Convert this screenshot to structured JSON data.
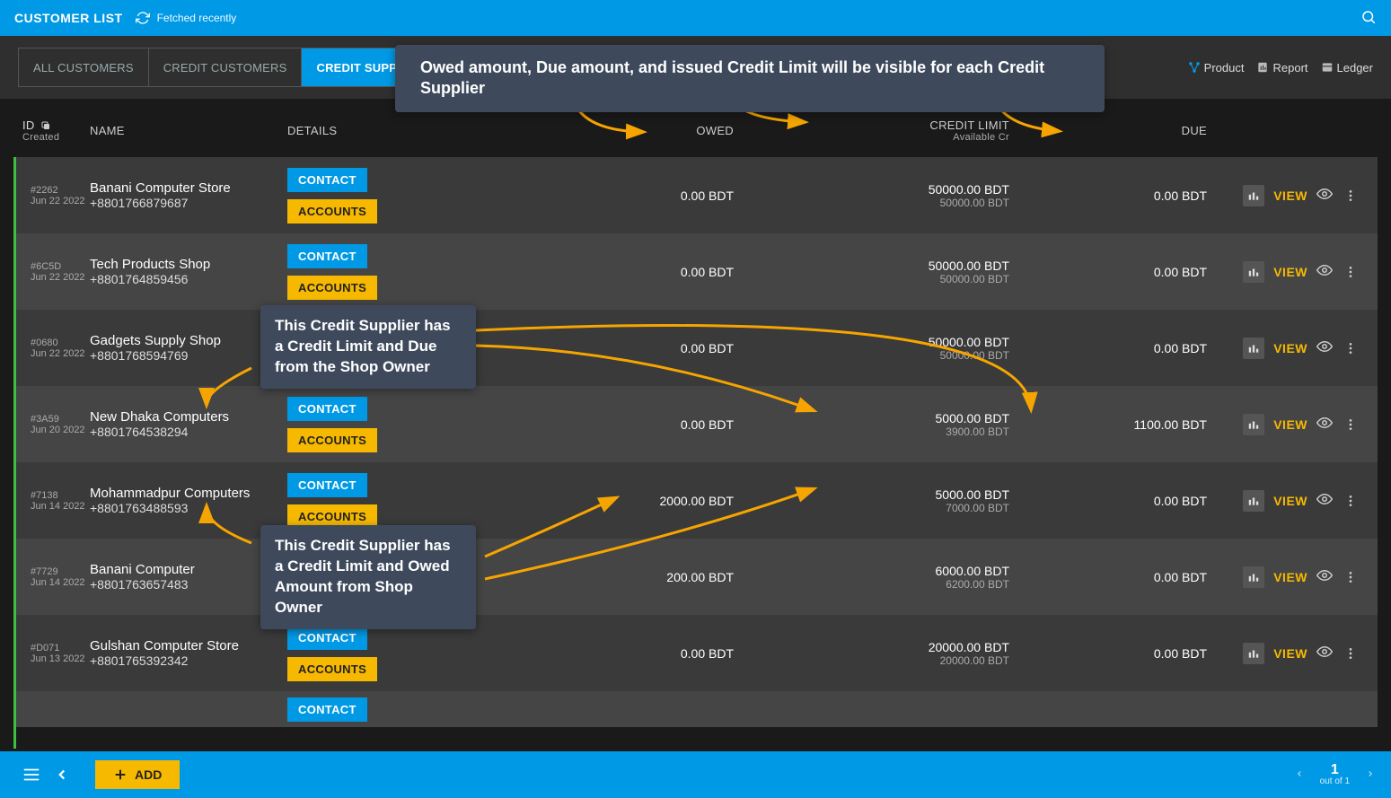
{
  "header": {
    "title": "CUSTOMER LIST",
    "refresh_label": "Fetched recently"
  },
  "tabs": [
    {
      "label": "ALL CUSTOMERS",
      "active": false
    },
    {
      "label": "CREDIT CUSTOMERS",
      "active": false
    },
    {
      "label": "CREDIT SUPPLIERS",
      "active": true
    }
  ],
  "links": {
    "product": "Product",
    "report": "Report",
    "ledger": "Ledger"
  },
  "annotations": {
    "banner": "Owed amount, Due amount, and issued Credit Limit will be visible for each Credit Supplier",
    "callout_due": "This Credit Supplier has a Credit Limit and Due from the Shop Owner",
    "callout_owed": "This Credit Supplier has a Credit Limit and Owed Amount from Shop Owner"
  },
  "columns": {
    "id": "ID",
    "id_sub": "Created",
    "name": "NAME",
    "details": "DETAILS",
    "owed": "OWED",
    "credit": "CREDIT LIMIT",
    "credit_sub": "Available Cr",
    "due": "DUE"
  },
  "button_labels": {
    "contact": "CONTACT",
    "accounts": "ACCOUNTS",
    "view": "VIEW",
    "add": "ADD"
  },
  "pager": {
    "page": "1",
    "total": "out of 1"
  },
  "rows": [
    {
      "cid": "#2262",
      "created": "Jun 22 2022",
      "name": "Banani Computer Store",
      "phone": "+8801766879687",
      "owed": "0.00 BDT",
      "credit": "50000.00 BDT",
      "available": "50000.00 BDT",
      "due": "0.00 BDT"
    },
    {
      "cid": "#6C5D",
      "created": "Jun 22 2022",
      "name": "Tech Products Shop",
      "phone": "+8801764859456",
      "owed": "0.00 BDT",
      "credit": "50000.00 BDT",
      "available": "50000.00 BDT",
      "due": "0.00 BDT"
    },
    {
      "cid": "#0680",
      "created": "Jun 22 2022",
      "name": "Gadgets Supply Shop",
      "phone": "+8801768594769",
      "owed": "0.00 BDT",
      "credit": "50000.00 BDT",
      "available": "50000.00 BDT",
      "due": "0.00 BDT"
    },
    {
      "cid": "#3A59",
      "created": "Jun 20 2022",
      "name": "New Dhaka Computers",
      "phone": "+8801764538294",
      "owed": "0.00 BDT",
      "credit": "5000.00 BDT",
      "available": "3900.00 BDT",
      "due": "1100.00 BDT"
    },
    {
      "cid": "#7138",
      "created": "Jun 14 2022",
      "name": "Mohammadpur Computers",
      "phone": "+8801763488593",
      "owed": "2000.00 BDT",
      "credit": "5000.00 BDT",
      "available": "7000.00 BDT",
      "due": "0.00 BDT"
    },
    {
      "cid": "#7729",
      "created": "Jun 14 2022",
      "name": "Banani Computer",
      "phone": "+8801763657483",
      "owed": "200.00 BDT",
      "credit": "6000.00 BDT",
      "available": "6200.00 BDT",
      "due": "0.00 BDT"
    },
    {
      "cid": "#D071",
      "created": "Jun 13 2022",
      "name": "Gulshan Computer Store",
      "phone": "+8801765392342",
      "owed": "0.00 BDT",
      "credit": "20000.00 BDT",
      "available": "20000.00 BDT",
      "due": "0.00 BDT"
    }
  ]
}
